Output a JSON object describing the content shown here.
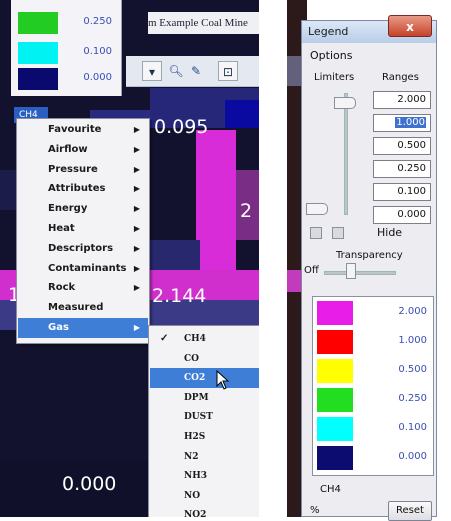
{
  "left_panel": {
    "legend_values": [
      "0.250",
      "0.100",
      "0.000"
    ],
    "legend_colors": [
      "#22cc22",
      "#00f2f2",
      "#0a0a6e"
    ],
    "app_title": "m  Example Coal Mine",
    "gas_chip": "CH4",
    "scene_labels": [
      "0.095",
      "2.144",
      "0.000",
      "1",
      "2"
    ],
    "context_menu": [
      {
        "label": "Favourite"
      },
      {
        "label": "Airflow"
      },
      {
        "label": "Pressure"
      },
      {
        "label": "Attributes"
      },
      {
        "label": "Energy"
      },
      {
        "label": "Heat"
      },
      {
        "label": "Descriptors"
      },
      {
        "label": "Contaminants"
      },
      {
        "label": "Rock"
      },
      {
        "label": "Measured"
      },
      {
        "label": "Gas"
      }
    ],
    "gas_menu": [
      "CH4",
      "CO",
      "CO2",
      "DPM",
      "DUST",
      "H2S",
      "N2",
      "NH3",
      "NO",
      "NO2"
    ],
    "checked_gas": "CH4",
    "highlighted_gas": "CO2",
    "highlighted_menu_item": "Gas"
  },
  "legend_window": {
    "title": "Legend",
    "close_glyph": "x",
    "options_label": "Options",
    "limiters_header": "Limiters",
    "ranges_header": "Ranges",
    "ranges": [
      "2.000",
      "1.000",
      "0.500",
      "0.250",
      "0.100",
      "0.000"
    ],
    "hide_label": "Hide",
    "transparency_label": "Transparency",
    "transparency_off": "Off",
    "legend_rows": [
      {
        "color": "#e81ee8",
        "value": "2.000"
      },
      {
        "color": "#ff0000",
        "value": "1.000"
      },
      {
        "color": "#ffff00",
        "value": "0.500"
      },
      {
        "color": "#22dd22",
        "value": "0.250"
      },
      {
        "color": "#00ffff",
        "value": "0.100"
      },
      {
        "color": "#0c0c70",
        "value": "0.000"
      }
    ],
    "gas_name": "CH4",
    "unit": "%",
    "reset_label": "Reset"
  }
}
